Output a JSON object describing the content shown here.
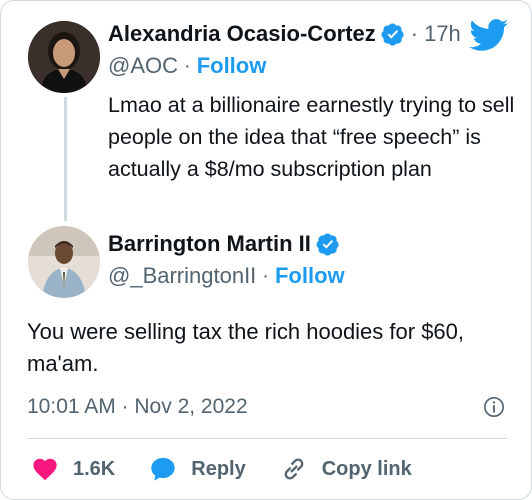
{
  "parent_tweet": {
    "author_name": "Alexandria Ocasio-Cortez",
    "handle": "@AOC",
    "separator": "·",
    "follow_label": "Follow",
    "time_ago": "17h",
    "text": "Lmao at a billionaire earnestly trying to sell people on the idea that “free speech” is actually a $8/mo subscription plan",
    "verified": true
  },
  "reply_tweet": {
    "author_name": "Barrington Martin II",
    "handle": "@_BarringtonII",
    "separator": "·",
    "follow_label": "Follow",
    "text": "You were selling tax the rich hoodies for $60, ma'am.",
    "timestamp": "10:01 AM · Nov 2, 2022",
    "verified": true
  },
  "actions": {
    "like_count": "1.6K",
    "reply_label": "Reply",
    "copy_link_label": "Copy link"
  },
  "colors": {
    "accent": "#1d9bf0",
    "like": "#f91880",
    "text": "#0f1419",
    "secondary": "#536471",
    "border": "#cfd9de"
  },
  "icons": [
    "twitter-bird-icon",
    "verified-badge-icon",
    "info-icon",
    "heart-icon",
    "reply-bubble-icon",
    "link-icon"
  ]
}
